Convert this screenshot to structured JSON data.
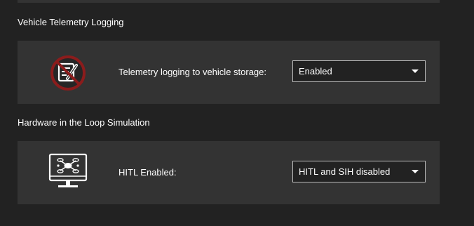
{
  "sections": [
    {
      "title": "Vehicle Telemetry Logging",
      "icon": "telemetry-logging-disabled-icon",
      "label": "Telemetry logging to vehicle storage:",
      "value": "Enabled"
    },
    {
      "title": "Hardware in the Loop Simulation",
      "icon": "hitl-monitor-icon",
      "label": "HITL Enabled:",
      "value": "HITL and SIH disabled"
    }
  ],
  "colors": {
    "background": "#222222",
    "panel": "#333333",
    "prohibit_red": "#8b1c1c",
    "text": "#ffffff"
  }
}
